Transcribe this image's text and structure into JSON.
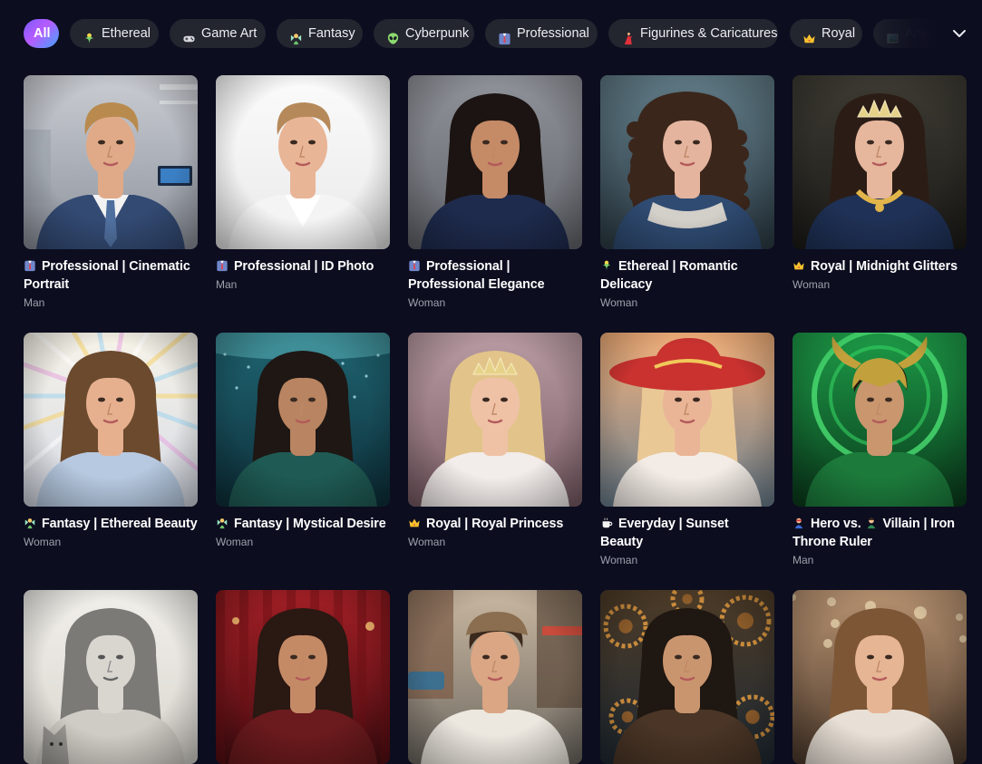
{
  "filters": [
    {
      "label": "All",
      "icon": "",
      "active": true
    },
    {
      "label": "Ethereal",
      "icon": "ethereal-icon"
    },
    {
      "label": "Game Art",
      "icon": "gamepad-icon"
    },
    {
      "label": "Fantasy",
      "icon": "fairy-icon"
    },
    {
      "label": "Cyberpunk",
      "icon": "alien-icon"
    },
    {
      "label": "Professional",
      "icon": "suit-icon"
    },
    {
      "label": "Figurines & Caricatures",
      "icon": "dancer-icon"
    },
    {
      "label": "Royal",
      "icon": "crown-icon"
    },
    {
      "label": "Artwork",
      "icon": "frame-icon"
    }
  ],
  "cards": [
    {
      "title": "Professional | Cinematic Portrait",
      "subtitle": "Man",
      "icon": "suit-icon",
      "image": "man-in-blue-suit-office"
    },
    {
      "title": "Professional | ID Photo",
      "subtitle": "Man",
      "icon": "suit-icon",
      "image": "man-white-shirt-white-background"
    },
    {
      "title": "Professional | Professional Elegance",
      "subtitle": "Woman",
      "icon": "suit-icon",
      "image": "woman-navy-dress-grey-background"
    },
    {
      "title": "Ethereal | Romantic Delicacy",
      "subtitle": "Woman",
      "icon": "ethereal-icon",
      "image": "woman-curly-hair-lace-dress"
    },
    {
      "title": "Royal | Midnight Glitters",
      "subtitle": "Woman",
      "icon": "crown-icon",
      "image": "woman-tiara-blue-gown"
    },
    {
      "title": "Fantasy | Ethereal Beauty",
      "subtitle": "Woman",
      "icon": "fairy-icon",
      "image": "woman-iridescent-light-rays"
    },
    {
      "title": "Fantasy | Mystical Desire",
      "subtitle": "Woman",
      "icon": "fairy-icon",
      "image": "woman-underwater-teal-dress"
    },
    {
      "title": "Royal | Royal Princess",
      "subtitle": "Woman",
      "icon": "crown-icon",
      "image": "blonde-princess-crown"
    },
    {
      "title": "Everyday | Sunset Beauty",
      "subtitle": "Woman",
      "icon": "coffee-icon",
      "image": "woman-red-hat-sunset"
    },
    {
      "title": "Hero vs. Villain | Iron Throne Ruler",
      "subtitle": "Man",
      "icon": "hero-icon",
      "icon2": "villain-icon",
      "image": "horned-green-armored-man"
    },
    {
      "title": "",
      "subtitle": "",
      "image": "pencil-sketch-woman-with-cat"
    },
    {
      "title": "",
      "subtitle": "",
      "image": "woman-red-theatre-curtain"
    },
    {
      "title": "",
      "subtitle": "",
      "image": "man-city-street-flat-cap"
    },
    {
      "title": "",
      "subtitle": "",
      "image": "woman-steampunk-gears"
    },
    {
      "title": "",
      "subtitle": "",
      "image": "woman-cafe-lights"
    }
  ],
  "colors": {
    "background": "#0c0d1f",
    "chip": "#23252f",
    "subtitle": "#9ea1ad",
    "active_gradient": [
      "#7b5cff",
      "#b65bff",
      "#3fa6ff"
    ]
  }
}
